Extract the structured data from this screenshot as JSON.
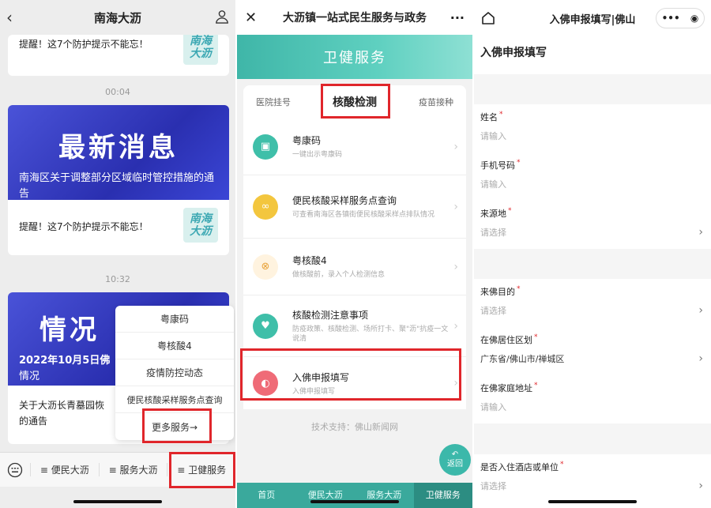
{
  "panel1": {
    "title": "南海大沥",
    "top_text": "提醒！这7个防护提示不能忘！",
    "badge_top": [
      "南海",
      "大沥"
    ],
    "time1": "00:04",
    "banner1_big": "最新消息",
    "banner1_sub": "南海区关于调整部分区域临时管控措施的通告",
    "card1_text": "提醒！这7个防护提示不能忘！",
    "badge1": [
      "南海",
      "大沥"
    ],
    "time2": "10:32",
    "banner2_big": "情况",
    "banner2_sub1": "2022年10月5日佛",
    "banner2_sub2": "情况",
    "card2_text1": "关于大沥长青墓园恢",
    "card2_text2": "的通告",
    "popup": [
      "粤康码",
      "粤核酸4",
      "疫情防控动态",
      "便民核酸采样服务点查询",
      "更多服务→"
    ],
    "tabs": [
      "便民大沥",
      "服务大沥",
      "卫健服务"
    ]
  },
  "panel2": {
    "title": "大沥镇一站式民生服务与政务",
    "banner": "卫健服务",
    "tabs": [
      "医院挂号",
      "核酸检测",
      "疫苗接种"
    ],
    "services": [
      {
        "title": "粤康码",
        "sub": "一键出示粤康码",
        "color": "#3fbfa9",
        "icon": "health-code-icon"
      },
      {
        "title": "便民核酸采样服务点查询",
        "sub": "可查看南海区各镇街便民核酸采样点排队情况",
        "color": "#f3c63e",
        "icon": "sampling-point-icon"
      },
      {
        "title": "粤核酸4",
        "sub": "做核酸前，录入个人检测信息",
        "color": "#f2b55a",
        "icon": "nucleic-acid-icon"
      },
      {
        "title": "核酸检测注意事项",
        "sub": "防疫政策、核酸检测、场所打卡、聚\"沥\"抗疫一文说清",
        "color": "#3fbfa9",
        "icon": "heart-icon"
      },
      {
        "title": "入佛申报填写",
        "sub": "入佛申报填写",
        "color": "#ef6b77",
        "icon": "declaration-icon"
      }
    ],
    "support": "技术支持：佛山新闻网",
    "fab": "返回",
    "bottom_tabs": [
      "首页",
      "便民大沥",
      "服务大沥",
      "卫健服务"
    ]
  },
  "panel3": {
    "title": "入佛申报填写|佛山",
    "page_title": "入佛申报填写",
    "group1": [
      {
        "label": "姓名",
        "value": "请输入",
        "chevron": false
      },
      {
        "label": "手机号码",
        "value": "请输入",
        "chevron": false
      },
      {
        "label": "来源地",
        "value": "请选择",
        "chevron": true
      }
    ],
    "group2": [
      {
        "label": "来佛目的",
        "value": "请选择",
        "chevron": true
      },
      {
        "label": "在佛居住区划",
        "value": "广东省/佛山市/禅城区",
        "chevron": true,
        "filled": true
      },
      {
        "label": "在佛家庭地址",
        "value": "请输入",
        "chevron": false
      }
    ],
    "group3": [
      {
        "label": "是否入住酒店或单位",
        "value": "请选择",
        "chevron": true
      }
    ],
    "required_mark": "*"
  }
}
